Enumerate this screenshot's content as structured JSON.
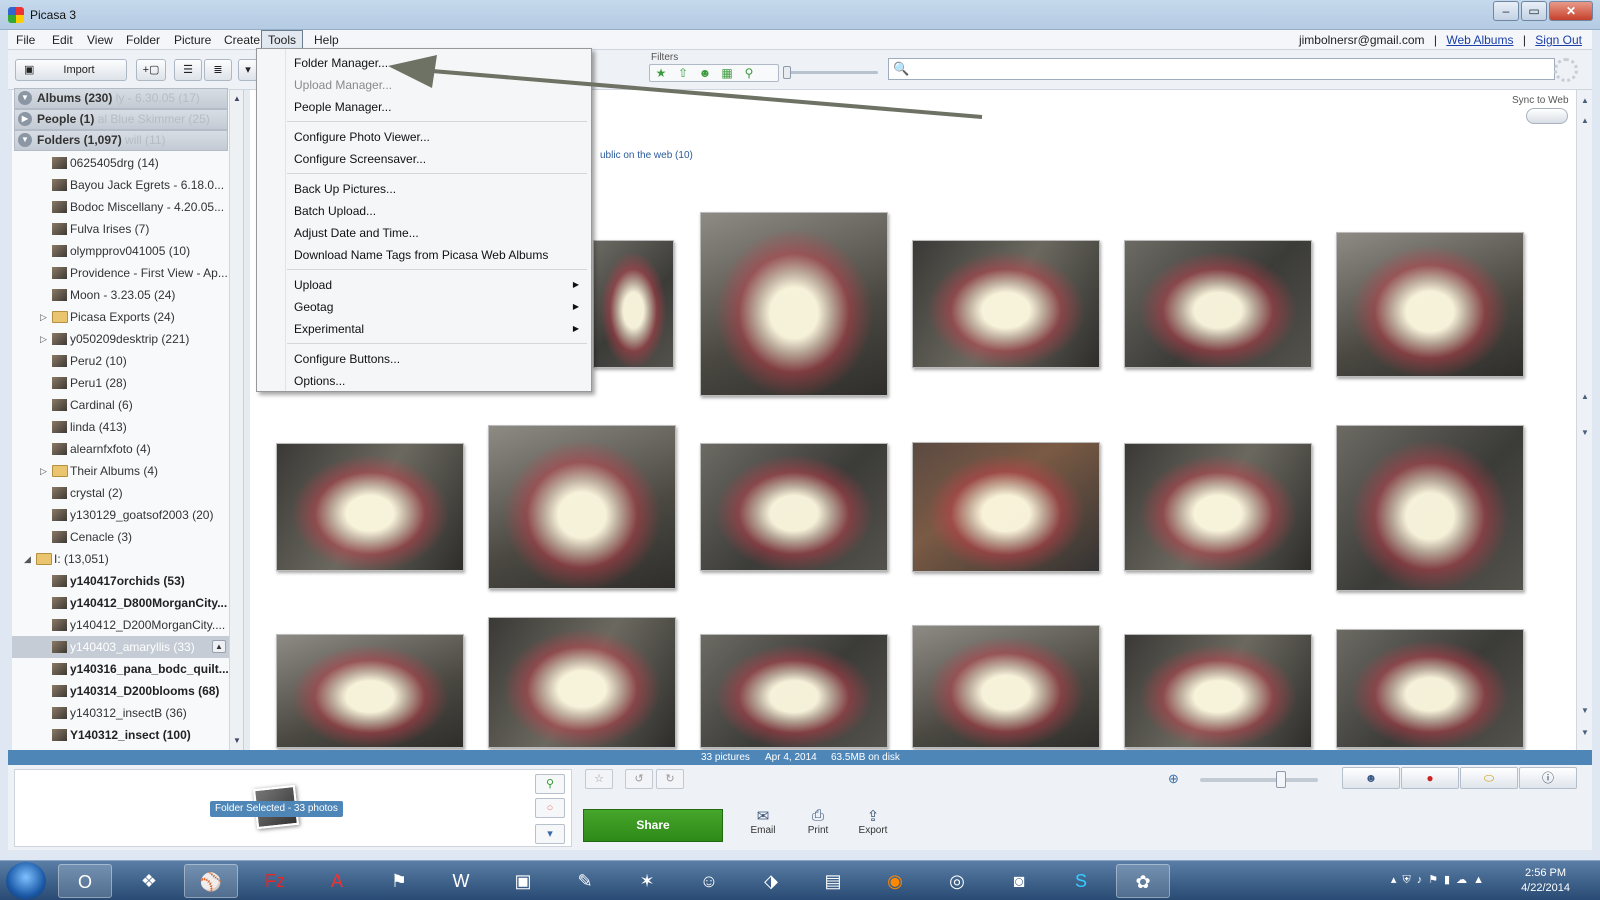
{
  "window": {
    "title": "Picasa 3",
    "controls": {
      "minimize": "–",
      "maximize": "▭",
      "close": "✕"
    }
  },
  "menubar": {
    "items": [
      "File",
      "Edit",
      "View",
      "Folder",
      "Picture",
      "Create",
      "Tools",
      "Help"
    ],
    "active": "Tools",
    "account": {
      "email": "jimbolnersr@gmail.com",
      "web_albums": "Web Albums",
      "sign_out": "Sign Out",
      "sep": "|"
    }
  },
  "toolbar": {
    "import_label": "Import",
    "filters_label": "Filters",
    "filter_icons": [
      "★",
      "⇧",
      "☻",
      "▦",
      "⚲"
    ],
    "search_value": "",
    "search_icon": "🔍"
  },
  "sidebar": {
    "sections": [
      {
        "label": "Albums (230)",
        "ghost": "ly - 6.30.05 (17)"
      },
      {
        "label": "People (1)",
        "ghost": "al Blue Skimmer (25)"
      },
      {
        "label": "Folders (1,097)",
        "ghost": "will (11)"
      }
    ],
    "items": [
      {
        "label": "0625405drg (14)"
      },
      {
        "label": "Bayou Jack Egrets - 6.18.0..."
      },
      {
        "label": "Bodoc Miscellany - 4.20.05..."
      },
      {
        "label": "Fulva Irises (7)"
      },
      {
        "label": "olympprov041005 (10)"
      },
      {
        "label": "Providence - First View - Ap..."
      },
      {
        "label": "Moon - 3.23.05 (24)"
      },
      {
        "label": "Picasa Exports (24)"
      },
      {
        "label": "y050209desktrip (221)"
      },
      {
        "label": "Peru2 (10)"
      },
      {
        "label": "Peru1 (28)"
      },
      {
        "label": "Cardinal (6)"
      },
      {
        "label": "linda (413)"
      },
      {
        "label": "alearnfxfoto (4)"
      },
      {
        "label": "Their Albums (4)"
      },
      {
        "label": "crystal (2)"
      },
      {
        "label": "y130129_goatsof2003 (20)"
      },
      {
        "label": "Cenacle (3)"
      },
      {
        "label": "I: (13,051)"
      },
      {
        "label": "y140417orchids (53)"
      },
      {
        "label": "y140412_D800MorganCity..."
      },
      {
        "label": "y140412_D200MorganCity...."
      },
      {
        "label": "y140403_amaryllis (33)"
      },
      {
        "label": "y140316_pana_bodc_quilt..."
      },
      {
        "label": "y140314_D200blooms (68)"
      },
      {
        "label": "y140312_insectB (36)"
      },
      {
        "label": "Y140312_insect (100)"
      }
    ]
  },
  "main": {
    "sync_label": "Sync to Web",
    "public_text": "ublic on the web (10)"
  },
  "tools_menu": {
    "items": [
      {
        "label": "Folder Manager..."
      },
      {
        "label": "Upload Manager..."
      },
      {
        "label": "People Manager..."
      },
      {
        "label": "Configure Photo Viewer..."
      },
      {
        "label": "Configure Screensaver..."
      },
      {
        "label": "Back Up Pictures..."
      },
      {
        "label": "Batch Upload..."
      },
      {
        "label": "Adjust Date and Time..."
      },
      {
        "label": "Download Name Tags from Picasa Web Albums"
      },
      {
        "label": "Upload"
      },
      {
        "label": "Geotag"
      },
      {
        "label": "Experimental"
      },
      {
        "label": "Configure Buttons..."
      },
      {
        "label": "Options..."
      }
    ],
    "submenu_arrow": "▶"
  },
  "status": {
    "count": "33 pictures",
    "date": "Apr 4, 2014",
    "size": "63.5MB on disk"
  },
  "tray": {
    "folder_selected": "Folder Selected - 33 photos",
    "share": "Share",
    "email": "Email",
    "print": "Print",
    "export": "Export",
    "icons": {
      "email": "✉",
      "print": "⎙",
      "export": "⇪",
      "pin": "⚲",
      "hold": "○",
      "more": "▾",
      "star": "☆",
      "rotl": "↺",
      "rotr": "↻",
      "zoom": "⊕",
      "person": "☻",
      "geo": "●",
      "tag": "⬭",
      "info": "ⓘ"
    }
  },
  "taskbar": {
    "time": "2:56 PM",
    "date": "4/22/2014",
    "apps": [
      "O",
      "❖",
      "⚾",
      "Fz",
      "A",
      "⚑",
      "W",
      "▣",
      "✎",
      "✶",
      "☺",
      "⬗",
      "▤",
      "◉",
      "◎",
      "◙",
      "S",
      "✿"
    ]
  }
}
